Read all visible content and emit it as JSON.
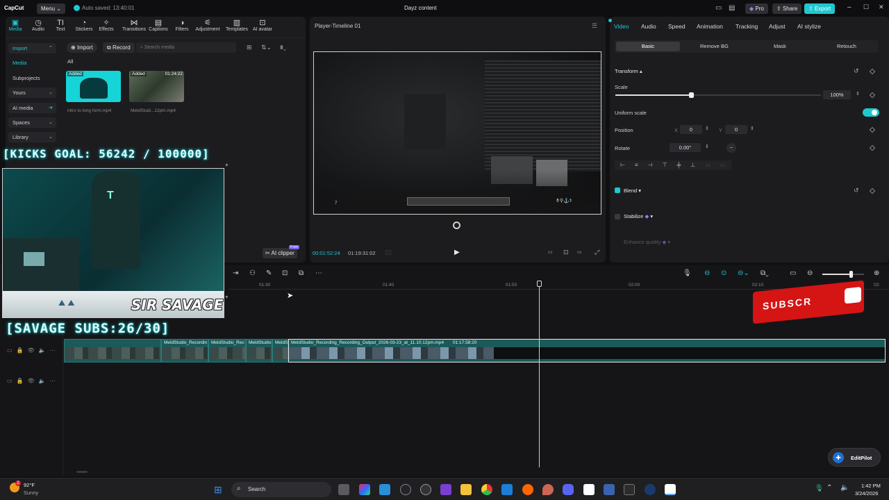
{
  "app": {
    "logo": "CapCut",
    "menu": "Menu",
    "autosave": "Auto saved: 13:40:01",
    "project_title": "Dayz content",
    "pro": "Pro",
    "share": "Share",
    "export": "Export"
  },
  "toolbar": {
    "items": [
      "Media",
      "Audio",
      "Text",
      "Stickers",
      "Effects",
      "Transitions",
      "Captions",
      "Filters",
      "Adjustment",
      "Templates",
      "AI avatar"
    ]
  },
  "sidebar": {
    "items": [
      "Import",
      "Media",
      "Subprojects",
      "Yours",
      "AI media",
      "Spaces",
      "Library"
    ]
  },
  "media": {
    "import_btn": "Import",
    "record_btn": "Record",
    "search_placeholder": "Search media",
    "filter_all": "All",
    "files": [
      {
        "badge": "Added",
        "name": "intro to long form.mp4",
        "duration": ""
      },
      {
        "badge": "Added",
        "name": "MeldStudi...12pm.mp4",
        "duration": "01:24:22"
      }
    ],
    "ai_clipper": "AI clipper",
    "free_badge": "Free"
  },
  "overlays": {
    "kicks_goal": "[KICKS GOAL: 56242 / 100000]",
    "savage_subs": "[SAVAGE SUBS:26/30]",
    "name_tag": "SIR SAVAGE",
    "subscribe": "SUBSCR"
  },
  "player": {
    "title": "Player-Timeline 01",
    "current_time": "00:01:52:24",
    "total_time": "01:19:31:02",
    "hud_num": "7"
  },
  "inspector": {
    "tabs": [
      "Video",
      "Audio",
      "Speed",
      "Animation",
      "Tracking",
      "Adjust",
      "AI stylize"
    ],
    "subtabs": [
      "Basic",
      "Remove BG",
      "Mask",
      "Retouch"
    ],
    "transform": "Transform",
    "scale_label": "Scale",
    "scale_value": "100%",
    "scale_level": 0.16,
    "uniform_scale": "Uniform scale",
    "position_label": "Position",
    "pos_x_label": "X",
    "pos_x": "0",
    "pos_y_label": "Y",
    "pos_y": "0",
    "rotate_label": "Rotate",
    "rotate_value": "0.00°",
    "blend": "Blend",
    "stabilize": "Stabilize",
    "enhance": "Enhance quality"
  },
  "timeline": {
    "ruler": [
      "01:30",
      "01:40",
      "01:50",
      "02:00",
      "02:10",
      "02:"
    ],
    "clips": [
      "MeldStudio_Recordin",
      "MeldStudio_Rec",
      "MeldStudio",
      "MeldS"
    ],
    "main_clip": "MeldStudio_Recording_Recording_Output_2026-03-23_at_11.10.12pm.mp4",
    "main_clip_duration": "01:17:58:20",
    "zoom_level": 0.68
  },
  "editpilot": "EditPilot",
  "taskbar": {
    "weather_temp": "92°F",
    "weather_text": "Sunny",
    "search": "Search",
    "time": "1:42 PM",
    "date": "3/24/2026"
  },
  "colors": {
    "accent": "#1fc8cf",
    "pro": "#7b5cf0"
  }
}
